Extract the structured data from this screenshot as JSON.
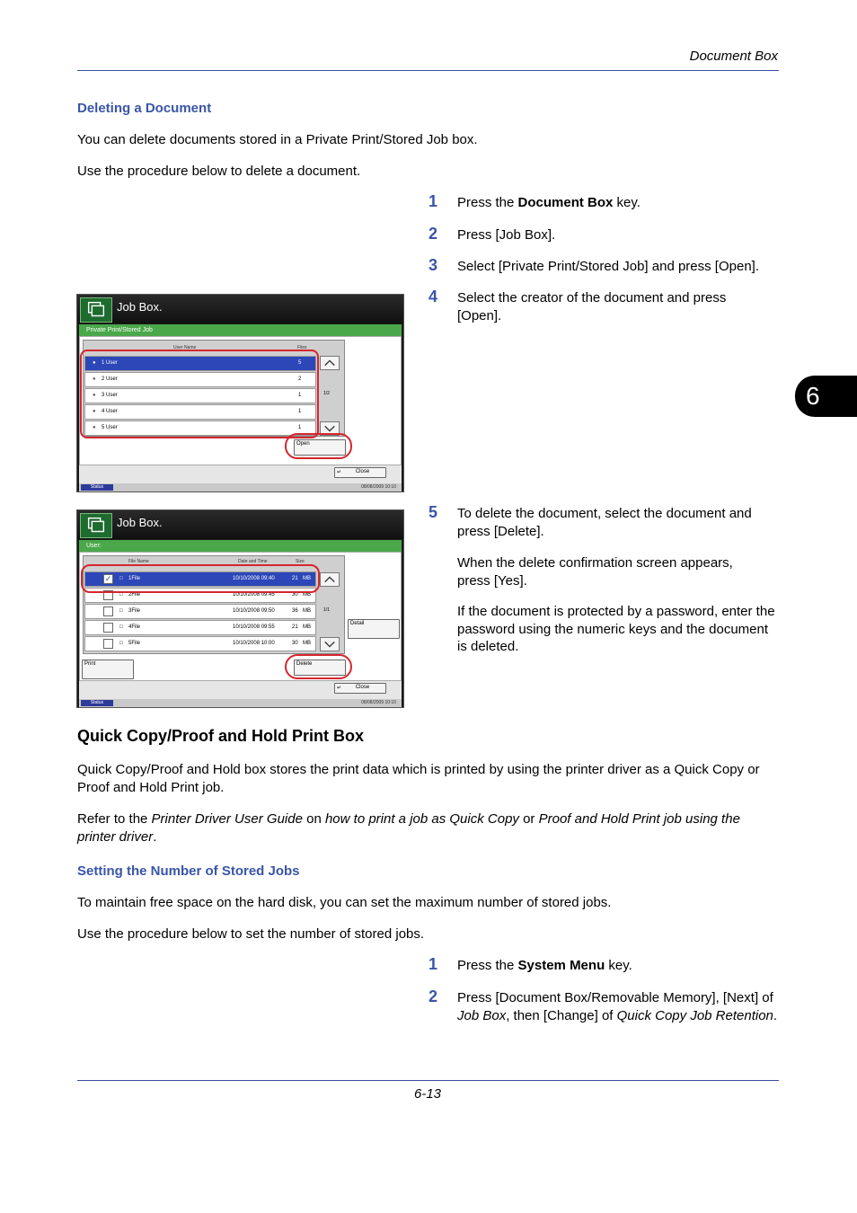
{
  "header": {
    "section": "Document Box"
  },
  "chapter_tab": "6",
  "deleting": {
    "title": "Deleting a Document",
    "p1": "You can delete documents stored in a Private Print/Stored Job box.",
    "p2": "Use the procedure below to delete a document.",
    "steps": [
      {
        "num": "1",
        "pre": "Press the ",
        "bold": "Document Box",
        "post": " key."
      },
      {
        "num": "2",
        "text": "Press [Job Box]."
      },
      {
        "num": "3",
        "text": "Select [Private Print/Stored Job] and press [Open]."
      },
      {
        "num": "4",
        "text": "Select the creator of the document and press [Open]."
      },
      {
        "num": "5",
        "text": "To delete the document, select the document and press [Delete].",
        "text2": "When the delete confirmation screen appears, press [Yes].",
        "text3": "If the document is protected by a password, enter the password using the numeric keys and the document is deleted."
      }
    ]
  },
  "screen1": {
    "title": "Job Box.",
    "bar": "Private Print/Stored Job",
    "col_user": "User Name",
    "col_files": "Files",
    "rows": [
      {
        "name": "1 User",
        "files": "5"
      },
      {
        "name": "2 User",
        "files": "2"
      },
      {
        "name": "3 User",
        "files": "1"
      },
      {
        "name": "4 User",
        "files": "1"
      },
      {
        "name": "5 User",
        "files": "1"
      }
    ],
    "page": "1/2",
    "open": "Open",
    "close": "Close",
    "status": "Status",
    "datetime": "08/08/2009    10:10"
  },
  "screen2": {
    "title": "Job Box.",
    "bar": "User:",
    "col_file": "File Name",
    "col_date": "Date and Time",
    "col_size": "Size",
    "rows": [
      {
        "name": "1File",
        "date": "10/10/2008 09:40",
        "size": "21",
        "unit": "MB"
      },
      {
        "name": "2File",
        "date": "10/10/2008 09:45",
        "size": "30",
        "unit": "MB"
      },
      {
        "name": "3File",
        "date": "10/10/2008 09:50",
        "size": "36",
        "unit": "MB"
      },
      {
        "name": "4File",
        "date": "10/10/2008 09:55",
        "size": "21",
        "unit": "MB"
      },
      {
        "name": "5File",
        "date": "10/10/2008 10:00",
        "size": "30",
        "unit": "MB"
      }
    ],
    "page": "1/1",
    "detail": "Detail",
    "print": "Print",
    "delete": "Delete",
    "close": "Close",
    "status": "Status",
    "datetime": "08/08/2009    10:10"
  },
  "quick": {
    "heading": "Quick Copy/Proof and Hold Print Box",
    "p1": "Quick Copy/Proof and Hold box stores the print data which is printed by using the printer driver as a Quick Copy or Proof and Hold Print job.",
    "p2_a": "Refer to the ",
    "p2_b": "Printer Driver User Guide",
    "p2_c": " on ",
    "p2_d": "how to print a job as Quick Copy",
    "p2_e": " or ",
    "p2_f": "Proof and Hold Print job using the printer driver",
    "p2_g": "."
  },
  "setting": {
    "title": "Setting the Number of Stored Jobs",
    "p1": "To maintain free space on the hard disk, you can set the maximum number of stored jobs.",
    "p2": "Use the procedure below to set the number of stored jobs.",
    "step1": {
      "num": "1",
      "pre": "Press the ",
      "bold": "System Menu",
      "post": " key."
    },
    "step2": {
      "num": "2",
      "a": "Press [Document Box/Removable Memory], [Next] of ",
      "b": "Job Box",
      "c": ", then [Change] of ",
      "d": "Quick Copy Job Retention",
      "e": "."
    }
  },
  "footer": {
    "page": "6-13"
  }
}
